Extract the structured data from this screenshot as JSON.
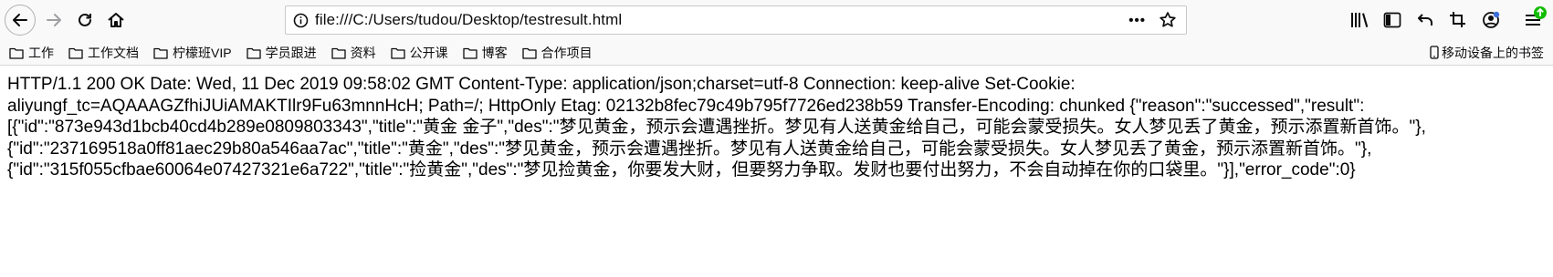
{
  "browser": {
    "url": "file:///C:/Users/tudou/Desktop/testresult.html",
    "page_actions_label": "•••",
    "icons": [
      "back-icon",
      "forward-icon",
      "reload-icon",
      "home-icon",
      "info-icon",
      "page-actions-icon",
      "star-icon",
      "library-icon",
      "sidebar-icon",
      "undo-icon",
      "crop-icon",
      "account-icon",
      "menu-icon"
    ],
    "accent_color": "#12bc00"
  },
  "bookmarks": {
    "items": [
      "工作",
      "工作文档",
      "柠檬班VIP",
      "学员跟进",
      "资料",
      "公开课",
      "博客",
      "合作项目"
    ],
    "mobile_label": "移动设备上的书签"
  },
  "page": {
    "lines": [
      "HTTP/1.1 200 OK Date: Wed, 11 Dec 2019 09:58:02 GMT Content-Type: application/json;charset=utf-8 Connection: keep-alive Set-Cookie:",
      "aliyungf_tc=AQAAAGZfhiJUiAMAKTIlr9Fu63mnnHcH; Path=/; HttpOnly Etag: 02132b8fec79c49b795f7726ed238b59 Transfer-Encoding: chunked {\"reason\":\"successed\",\"result\":",
      "[{\"id\":\"873e943d1bcb40cd4b289e0809803343\",\"title\":\"黄金 金子\",\"des\":\"梦见黄金，预示会遭遇挫折。梦见有人送黄金给自己，可能会蒙受损失。女人梦见丢了黄金，预示添置新首饰。\"},",
      "{\"id\":\"237169518a0ff81aec29b80a546aa7ac\",\"title\":\"黄金\",\"des\":\"梦见黄金，预示会遭遇挫折。梦见有人送黄金给自己，可能会蒙受损失。女人梦见丢了黄金，预示添置新首饰。\"},",
      "{\"id\":\"315f055cfbae60064e07427321e6a722\",\"title\":\"捡黄金\",\"des\":\"梦见捡黄金，你要发大财，但要努力争取。发财也要付出努力，不会自动掉在你的口袋里。\"}],\"error_code\":0}"
    ]
  }
}
